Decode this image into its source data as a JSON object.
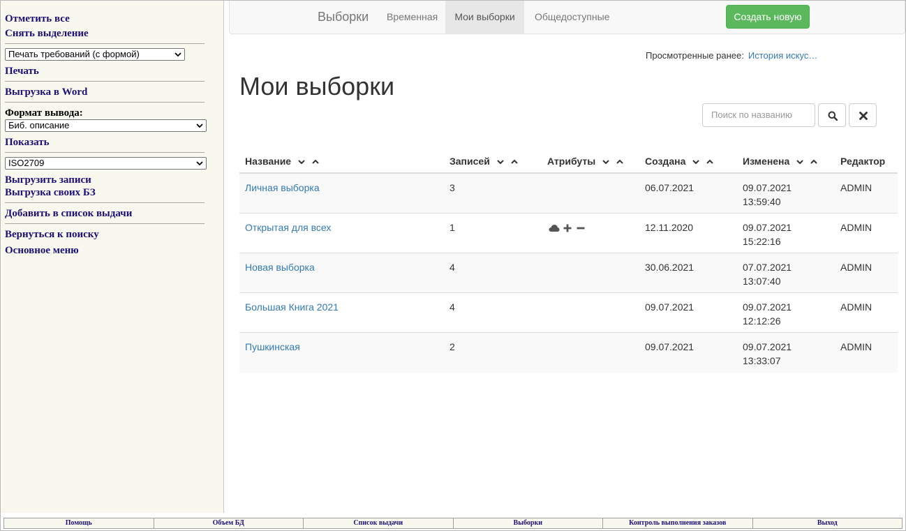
{
  "sidebar": {
    "select_all": "Отметить все",
    "deselect": "Снять выделение",
    "print_select": "Печать требований (с формой)",
    "print": "Печать",
    "export_word": "Выгрузка в Word",
    "output_format_label": "Формат вывода:",
    "format_select": "Биб. описание",
    "show": "Показать",
    "export_format_select": "ISO2709",
    "export_records": "Выгрузить записи",
    "export_own_db": "Выгрузка своих БЗ",
    "add_to_issue": "Добавить в список выдачи",
    "back_to_search": "Вернуться к поиску",
    "main_menu": "Основное меню"
  },
  "navbar": {
    "brand": "Выборки",
    "tabs": [
      "Временная",
      "Мои выборки",
      "Общедоступные"
    ],
    "active_tab": "Мои выборки",
    "create_button": "Создать новую"
  },
  "recent": {
    "label": "Просмотренные ранее:",
    "link": "История искус…"
  },
  "page_title": "Мои выборки",
  "search": {
    "placeholder": "Поиск по названию"
  },
  "table": {
    "columns": [
      "Название",
      "Записей",
      "Атрибуты",
      "Создана",
      "Изменена",
      "Редактор"
    ],
    "rows": [
      {
        "name": "Личная выборка",
        "count": "3",
        "attributes": [],
        "created": "06.07.2021",
        "modified_date": "09.07.2021",
        "modified_time": "13:59:40",
        "editor": "ADMIN"
      },
      {
        "name": "Открытая для всех",
        "count": "1",
        "attributes": [
          "cloud-icon",
          "plus-icon",
          "minus-icon"
        ],
        "created": "12.11.2020",
        "modified_date": "09.07.2021",
        "modified_time": "15:22:16",
        "editor": "ADMIN"
      },
      {
        "name": "Новая выборка",
        "count": "4",
        "attributes": [],
        "created": "30.06.2021",
        "modified_date": "07.07.2021",
        "modified_time": "13:07:40",
        "editor": "ADMIN"
      },
      {
        "name": "Большая Книга 2021",
        "count": "4",
        "attributes": [],
        "created": "09.07.2021",
        "modified_date": "09.07.2021",
        "modified_time": "12:12:26",
        "editor": "ADMIN"
      },
      {
        "name": "Пушкинская",
        "count": "2",
        "attributes": [],
        "created": "09.07.2021",
        "modified_date": "09.07.2021",
        "modified_time": "13:33:07",
        "editor": "ADMIN"
      }
    ]
  },
  "footer": {
    "items": [
      "Помощь",
      "Объем БД",
      "Список выдачи",
      "Выборки",
      "Контроль выполнения заказов",
      "Выход"
    ]
  },
  "colors": {
    "sidebar_bg": "#f8f8ef",
    "sidebar_link": "#1c0f7a",
    "link_blue": "#337ab7",
    "create_green": "#5cb85c"
  }
}
